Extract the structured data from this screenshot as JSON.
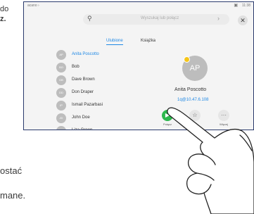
{
  "background": {
    "top_text": "do",
    "top_text_bold": "z.",
    "mid_text": "ostać",
    "bottom_text": "mane."
  },
  "status": {
    "room": "acano ›",
    "time": "11:38",
    "camera_icon": "camera-icon"
  },
  "search": {
    "placeholder": "Wyszukaj lub połącz",
    "icon": "search-icon"
  },
  "tabs": {
    "favorites": "Ulubione",
    "book": "Książka"
  },
  "contacts": [
    {
      "initials": "AP",
      "name": "Anita Poscotto",
      "selected": true
    },
    {
      "initials": "BO",
      "name": "Bob",
      "selected": false
    },
    {
      "initials": "DB",
      "name": "Dave Brown",
      "selected": false
    },
    {
      "initials": "DD",
      "name": "Don Draper",
      "selected": false
    },
    {
      "initials": "IP",
      "name": "Ismail Pazarbasi",
      "selected": false
    },
    {
      "initials": "JD",
      "name": "John Doe",
      "selected": false
    },
    {
      "initials": "LG",
      "name": "Liza Green",
      "selected": false
    }
  ],
  "detail": {
    "initials": "AP",
    "name": "Anita Poscotto",
    "address": "1q@10.47.6.108",
    "call_label": "Połącz",
    "more_label": "Więcej"
  },
  "colors": {
    "accent": "#1e88e5",
    "call_green": "#2db84d",
    "favorite_star": "#f5c518",
    "frame_border": "#2a3a6c"
  }
}
